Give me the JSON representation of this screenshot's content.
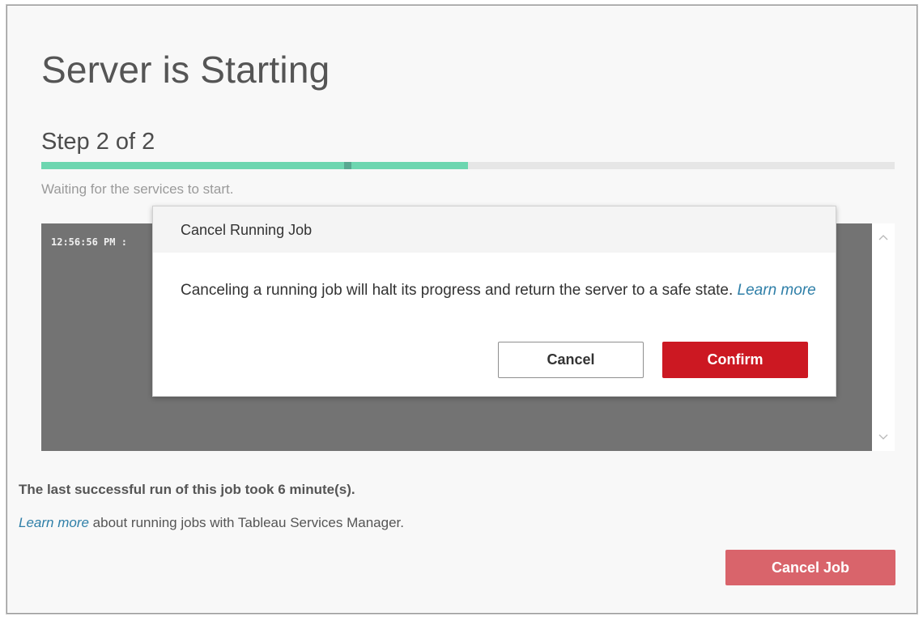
{
  "page": {
    "title": "Server is Starting",
    "step_label": "Step 2 of 2",
    "progress_percent": 50,
    "status_text": "Waiting for the services to start."
  },
  "log": {
    "lines": [
      "12:56:56 PM :"
    ]
  },
  "footer": {
    "last_run_text": "The last successful run of this job took 6 minute(s).",
    "learn_more_link": "Learn more",
    "learn_more_rest": " about running jobs with Tableau Services Manager.",
    "cancel_job_label": "Cancel Job"
  },
  "modal": {
    "title": "Cancel Running Job",
    "message": "Canceling a running job will halt its progress and return the server to a safe state.",
    "learn_more_link": "Learn more",
    "cancel_label": "Cancel",
    "confirm_label": "Confirm"
  },
  "colors": {
    "progress": "#6dd6b0",
    "danger": "#cc1822",
    "danger_light": "#d9646b",
    "link": "#2f7fa8",
    "log_background": "#737373"
  },
  "icons": {
    "scroll_up": "chevron-up-icon",
    "scroll_down": "chevron-down-icon"
  }
}
